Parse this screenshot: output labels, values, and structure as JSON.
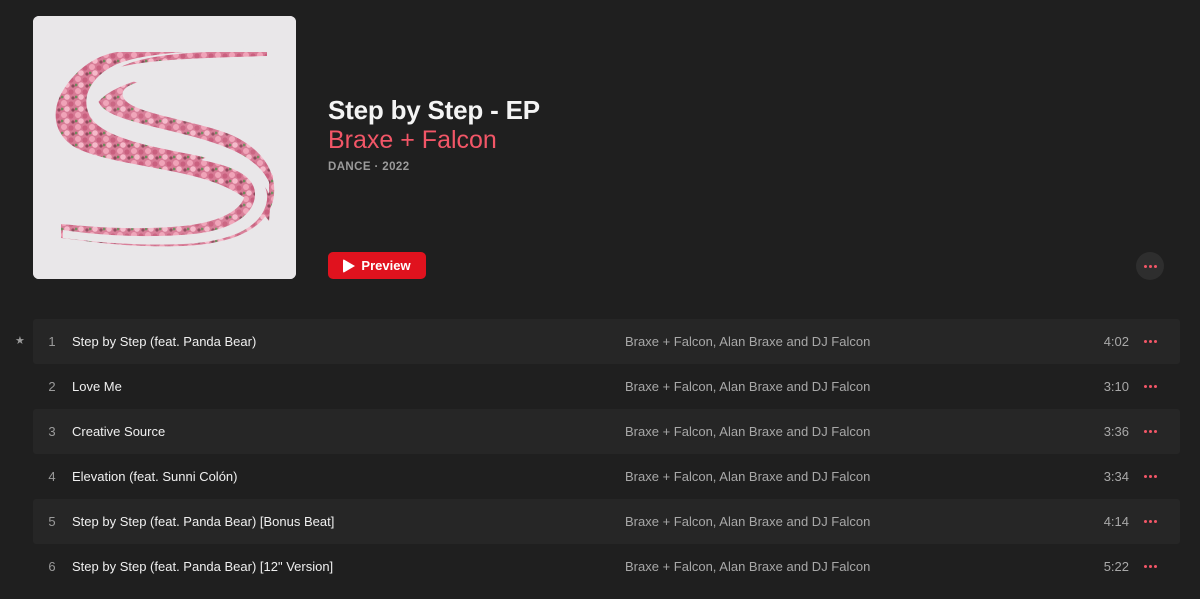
{
  "album": {
    "title": "Step by Step - EP",
    "artist": "Braxe + Falcon",
    "meta": "DANCE · 2022",
    "artwork_icon": "album-artwork-s-logo"
  },
  "actions": {
    "preview_label": "Preview",
    "more_icon": "ellipsis-icon"
  },
  "colors": {
    "background": "#1f1f1f",
    "accent": "#f25667",
    "preview_button": "#e0121e",
    "alt_row": "#262626"
  },
  "tracks": [
    {
      "number": "1",
      "title": "Step by Step (feat. Panda Bear)",
      "artists": "Braxe + Falcon, Alan Braxe and DJ Falcon",
      "duration": "4:02",
      "starred": true
    },
    {
      "number": "2",
      "title": "Love Me",
      "artists": "Braxe + Falcon, Alan Braxe and DJ Falcon",
      "duration": "3:10",
      "starred": false
    },
    {
      "number": "3",
      "title": "Creative Source",
      "artists": "Braxe + Falcon, Alan Braxe and DJ Falcon",
      "duration": "3:36",
      "starred": false
    },
    {
      "number": "4",
      "title": "Elevation (feat. Sunni Colón)",
      "artists": "Braxe + Falcon, Alan Braxe and DJ Falcon",
      "duration": "3:34",
      "starred": false
    },
    {
      "number": "5",
      "title": "Step by Step (feat. Panda Bear) [Bonus Beat]",
      "artists": "Braxe + Falcon, Alan Braxe and DJ Falcon",
      "duration": "4:14",
      "starred": false
    },
    {
      "number": "6",
      "title": "Step by Step (feat. Panda Bear) [12\" Version]",
      "artists": "Braxe + Falcon, Alan Braxe and DJ Falcon",
      "duration": "5:22",
      "starred": false
    }
  ],
  "star_glyph": "★"
}
